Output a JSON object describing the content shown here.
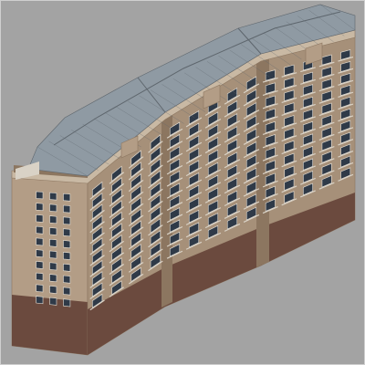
{
  "viewport": {
    "background": "#a3a3a3",
    "frame_color": "#cfcfcf",
    "render_mode": "shaded"
  },
  "model": {
    "object": "building-model",
    "colors": {
      "wall": "#a69079",
      "wall_dark": "#8c7660",
      "wall_light": "#b39d86",
      "trim": "#c9b9a4",
      "window": "#2f3a48",
      "window_frame": "#e8e2d8",
      "base_brick": "#6b4a3e",
      "roof": "#8f9aa3",
      "roof_line": "#5e666d",
      "rail": "#d9d2c6"
    }
  }
}
